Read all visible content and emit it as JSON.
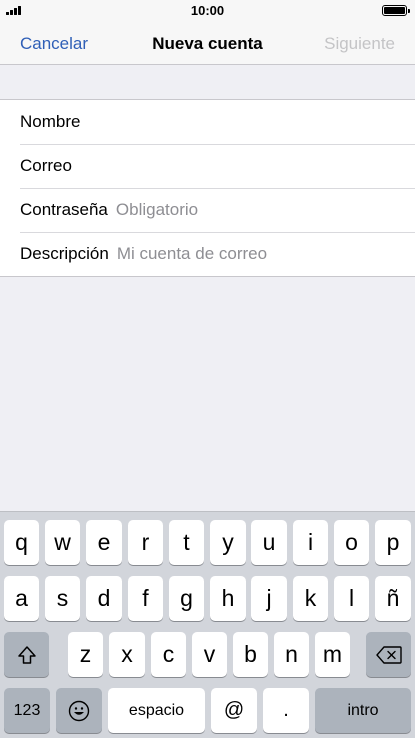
{
  "status_bar": {
    "time": "10:00"
  },
  "nav": {
    "cancel_label": "Cancelar",
    "title": "Nueva cuenta",
    "next_label": "Siguiente"
  },
  "form": {
    "rows": [
      {
        "label": "Nombre",
        "placeholder": ""
      },
      {
        "label": "Correo",
        "placeholder": ""
      },
      {
        "label": "Contraseña",
        "placeholder": "Obligatorio"
      },
      {
        "label": "Descripción",
        "placeholder": "Mi cuenta de correo"
      }
    ]
  },
  "keyboard": {
    "row1": [
      "q",
      "w",
      "e",
      "r",
      "t",
      "y",
      "u",
      "i",
      "o",
      "p"
    ],
    "row2": [
      "a",
      "s",
      "d",
      "f",
      "g",
      "h",
      "j",
      "k",
      "l",
      "ñ"
    ],
    "row3": [
      "z",
      "x",
      "c",
      "v",
      "b",
      "n",
      "m"
    ],
    "numbers_label": "123",
    "space_label": "espacio",
    "at_label": "@",
    "dot_label": ".",
    "return_label": "intro"
  },
  "colors": {
    "accent": "#2f5fb7",
    "disabled": "#c4c4c6",
    "placeholder": "#8e8e93",
    "background": "#efeff4",
    "keyboard_bg": "#d2d5db"
  }
}
